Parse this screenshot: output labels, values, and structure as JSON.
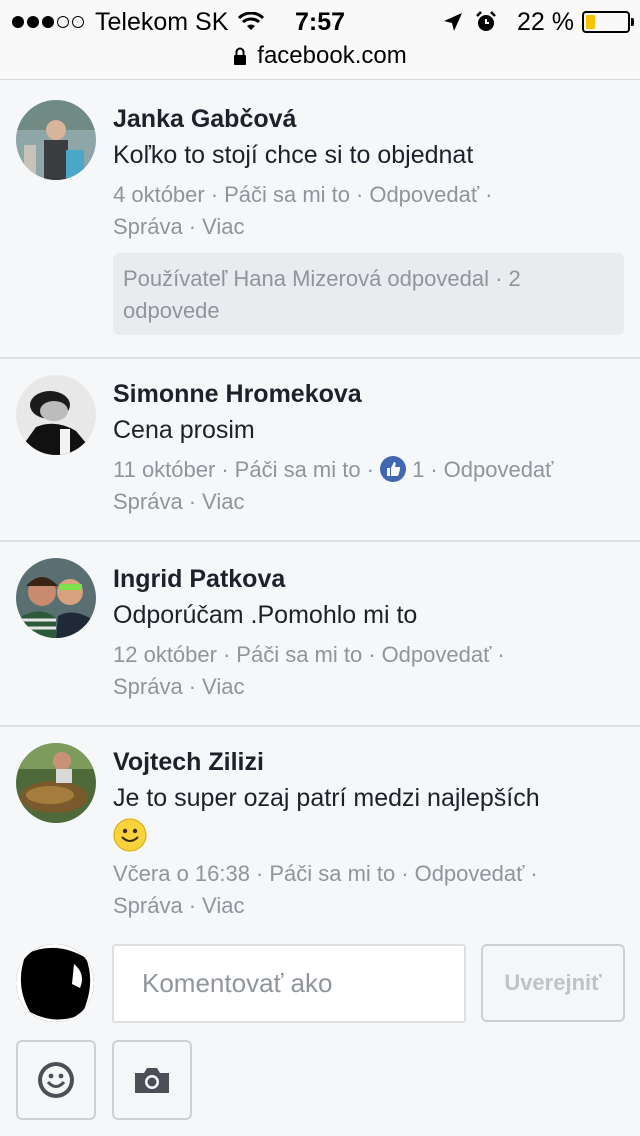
{
  "status_bar": {
    "carrier": "Telekom SK",
    "time": "7:57",
    "battery_percent": "22 %",
    "battery_level": 0.22,
    "url": "facebook.com"
  },
  "comments": [
    {
      "author": "Janka Gabčová",
      "text": "Koľko to stojí chce si to objednat",
      "date": "4 október",
      "like": "Páči sa mi to",
      "reply": "Odpovedať",
      "message": "Správa",
      "more": "Viac",
      "replies_summary": "Používateľ Hana Mizerová odpovedal · 2 odpovede"
    },
    {
      "author": "Simonne Hromekova",
      "text": "Cena prosim",
      "date": "11 október",
      "like": "Páči sa mi to",
      "like_count": "1",
      "reply": "Odpovedať",
      "message": "Správa",
      "more": "Viac"
    },
    {
      "author": "Ingrid Patkova",
      "text": "Odporúčam .Pomohlo mi to",
      "date": "12 október",
      "like": "Páči sa mi to",
      "reply": "Odpovedať",
      "message": "Správa",
      "more": "Viac"
    },
    {
      "author": "Vojtech Zilizi",
      "text": "Je to super ozaj patrí medzi najlepších",
      "date": "Včera o 16:38",
      "like": "Páči sa mi to",
      "reply": "Odpovedať",
      "message": "Správa",
      "more": "Viac"
    }
  ],
  "composer": {
    "placeholder": "Komentovať ako",
    "post_label": "Uverejniť"
  },
  "colors": {
    "link_gray": "#90949c",
    "like_blue": "#4267b2",
    "background": "#f6f7f9"
  }
}
